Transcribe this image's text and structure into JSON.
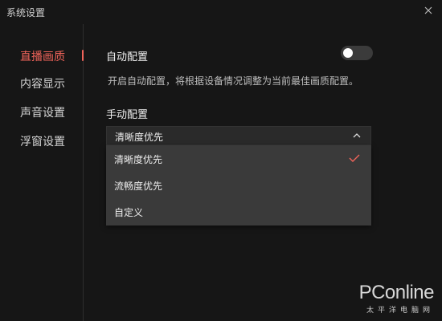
{
  "window": {
    "title": "系统设置"
  },
  "sidebar": {
    "items": [
      {
        "label": "直播画质",
        "active": true
      },
      {
        "label": "内容显示",
        "active": false
      },
      {
        "label": "声音设置",
        "active": false
      },
      {
        "label": "浮窗设置",
        "active": false
      }
    ]
  },
  "auto_config": {
    "title": "自动配置",
    "toggle_on": false,
    "description": "开启自动配置，将根据设备情况调整为当前最佳画质配置。"
  },
  "manual_config": {
    "title": "手动配置",
    "selected": "清晰度优先",
    "options": [
      {
        "label": "清晰度优先",
        "checked": true
      },
      {
        "label": "流畅度优先",
        "checked": false
      },
      {
        "label": "自定义",
        "checked": false
      }
    ]
  },
  "watermark": {
    "main": "PConline",
    "sub": "太平洋电脑网"
  },
  "colors": {
    "accent": "#f0645a",
    "background": "#161616",
    "dropdown_bg": "#3a3a3a"
  },
  "icons": {
    "close": "close-icon",
    "chevron": "chevron-up-icon",
    "check": "check-icon"
  }
}
